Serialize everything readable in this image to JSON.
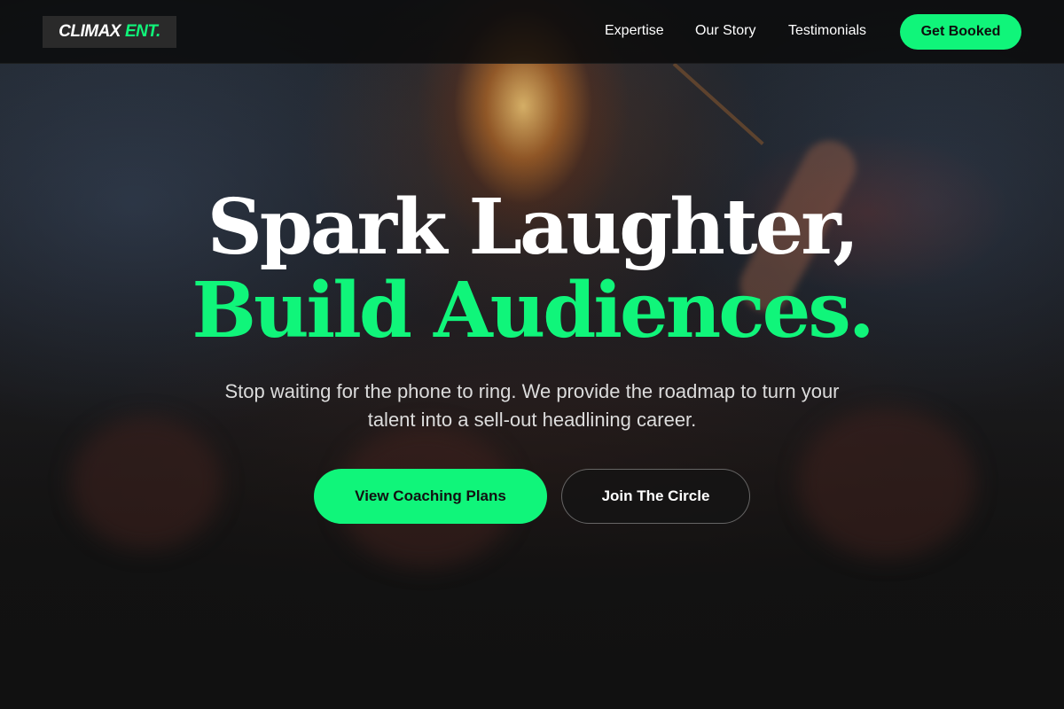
{
  "brand": {
    "name": "CLIMAX",
    "suffix": "ENT.",
    "accent_color": "#10f57a"
  },
  "nav": {
    "items": [
      {
        "label": "Expertise"
      },
      {
        "label": "Our Story"
      },
      {
        "label": "Testimonials"
      }
    ],
    "cta_label": "Get Booked"
  },
  "hero": {
    "title_line1": "Spark Laughter,",
    "title_line2": "Build Audiences.",
    "subtitle": "Stop waiting for the phone to ring. We provide the roadmap to turn your talent into a sell-out headlining career.",
    "primary_button": "View Coaching Plans",
    "secondary_button": "Join The Circle"
  }
}
